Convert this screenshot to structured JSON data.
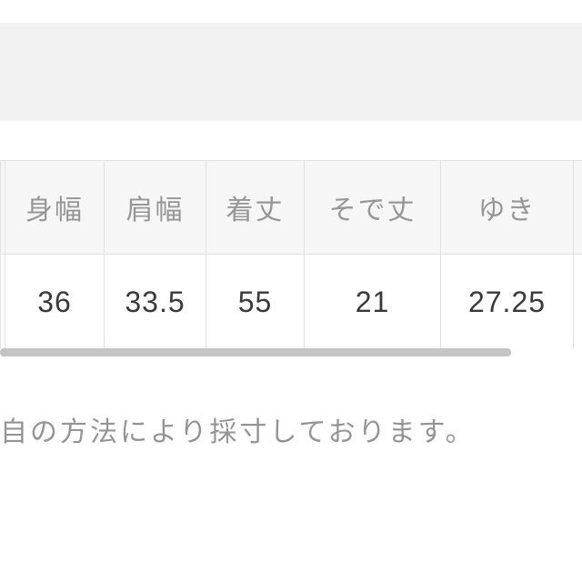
{
  "chart_data": {
    "type": "table",
    "headers": [
      "身幅",
      "肩幅",
      "着丈",
      "そで丈",
      "ゆき"
    ],
    "rows": [
      [
        36,
        33.5,
        55,
        21,
        27.25
      ]
    ]
  },
  "table": {
    "headers": {
      "c1": "身幅",
      "c2": "肩幅",
      "c3": "着丈",
      "c4": "そで丈",
      "c5": "ゆき"
    },
    "row1": {
      "c1": "36",
      "c2": "33.5",
      "c3": "55",
      "c4": "21",
      "c5": "27.25"
    }
  },
  "note": "自の方法により採寸しております。"
}
